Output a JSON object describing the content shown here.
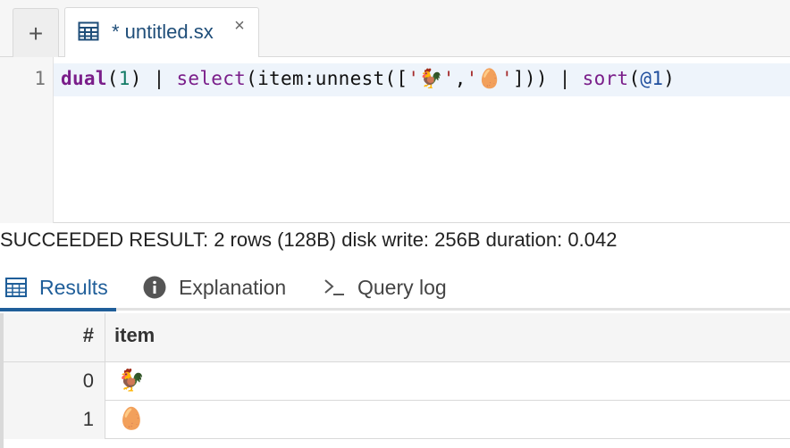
{
  "tabbar": {
    "new_tab_label": "+",
    "active_tab": {
      "label": "* untitled.sx",
      "close_label": "×",
      "icon": "sx-file-icon"
    }
  },
  "editor": {
    "line_numbers": [
      "1"
    ],
    "code_tokens": {
      "t1": "dual",
      "t2": "(",
      "t3": "1",
      "t4": ") | ",
      "t5": "select",
      "t6": "(item:unnest([",
      "t7": "'🐓'",
      "t8": ",",
      "t9": "'🥚'",
      "t10": "])) | ",
      "t11": "sort",
      "t12": "(",
      "t13": "@1",
      "t14": ")"
    }
  },
  "status": {
    "text": "SUCCEEDED RESULT: 2 rows (128B) disk write: 256B duration: 0.042"
  },
  "result_tabs": [
    {
      "label": "Results",
      "icon": "table-grid-icon",
      "active": true
    },
    {
      "label": "Explanation",
      "icon": "info-circle-icon",
      "active": false
    },
    {
      "label": "Query log",
      "icon": "terminal-prompt-icon",
      "active": false
    }
  ],
  "table": {
    "columns": [
      "#",
      "item"
    ],
    "rows": [
      {
        "index": "0",
        "item": "🐓"
      },
      {
        "index": "1",
        "item": "🥚"
      }
    ]
  },
  "colors": {
    "accent": "#1f5e99",
    "tab_label": "#1f4e79",
    "keyword": "#7a1e8a",
    "gutter_bg": "#f6f6f6"
  }
}
